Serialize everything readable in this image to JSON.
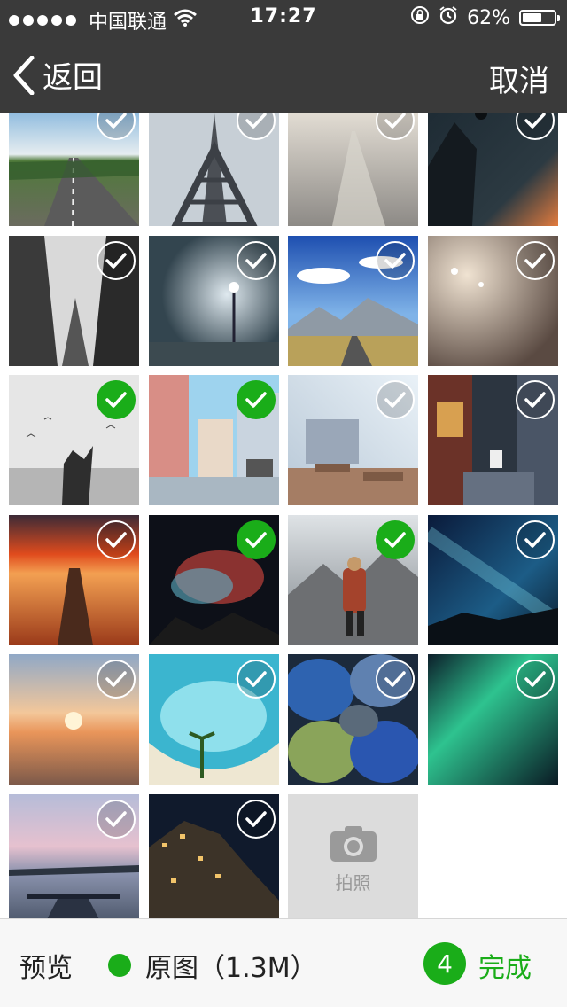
{
  "status_bar": {
    "carrier": "中国联通",
    "time": "17:27",
    "battery_text": "62%",
    "battery_level": 0.62
  },
  "nav": {
    "back_label": "返回",
    "cancel_label": "取消"
  },
  "photos": [
    {
      "id": "p1",
      "checked": false,
      "theme": "road"
    },
    {
      "id": "p2",
      "checked": false,
      "theme": "eiffel"
    },
    {
      "id": "p3",
      "checked": false,
      "theme": "fogroad"
    },
    {
      "id": "p4",
      "checked": false,
      "theme": "balloon"
    },
    {
      "id": "p5",
      "checked": false,
      "theme": "bw-buildings"
    },
    {
      "id": "p6",
      "checked": false,
      "theme": "fog-lamps"
    },
    {
      "id": "p7",
      "checked": false,
      "theme": "mountain-road"
    },
    {
      "id": "p8",
      "checked": false,
      "theme": "fog-street"
    },
    {
      "id": "p9",
      "checked": true,
      "theme": "bw-birds"
    },
    {
      "id": "p10",
      "checked": true,
      "theme": "anime-street"
    },
    {
      "id": "p11",
      "checked": false,
      "theme": "classroom"
    },
    {
      "id": "p12",
      "checked": false,
      "theme": "shop-street"
    },
    {
      "id": "p13",
      "checked": false,
      "theme": "pier-sunset"
    },
    {
      "id": "p14",
      "checked": true,
      "theme": "nebula"
    },
    {
      "id": "p15",
      "checked": true,
      "theme": "hiker"
    },
    {
      "id": "p16",
      "checked": false,
      "theme": "milkyway"
    },
    {
      "id": "p17",
      "checked": false,
      "theme": "sea-sunset"
    },
    {
      "id": "p18",
      "checked": false,
      "theme": "tropical"
    },
    {
      "id": "p19",
      "checked": false,
      "theme": "pebbles"
    },
    {
      "id": "p20",
      "checked": false,
      "theme": "aurora"
    },
    {
      "id": "p21",
      "checked": false,
      "theme": "pier-dusk"
    },
    {
      "id": "p22",
      "checked": false,
      "theme": "cliff-town"
    }
  ],
  "camera": {
    "label": "拍照"
  },
  "bottom": {
    "preview_label": "预览",
    "original_label": "原图（1.3M）",
    "selected_count": "4",
    "done_label": "完成"
  },
  "colors": {
    "accent": "#1aad19",
    "bar": "#3a3a3a"
  }
}
